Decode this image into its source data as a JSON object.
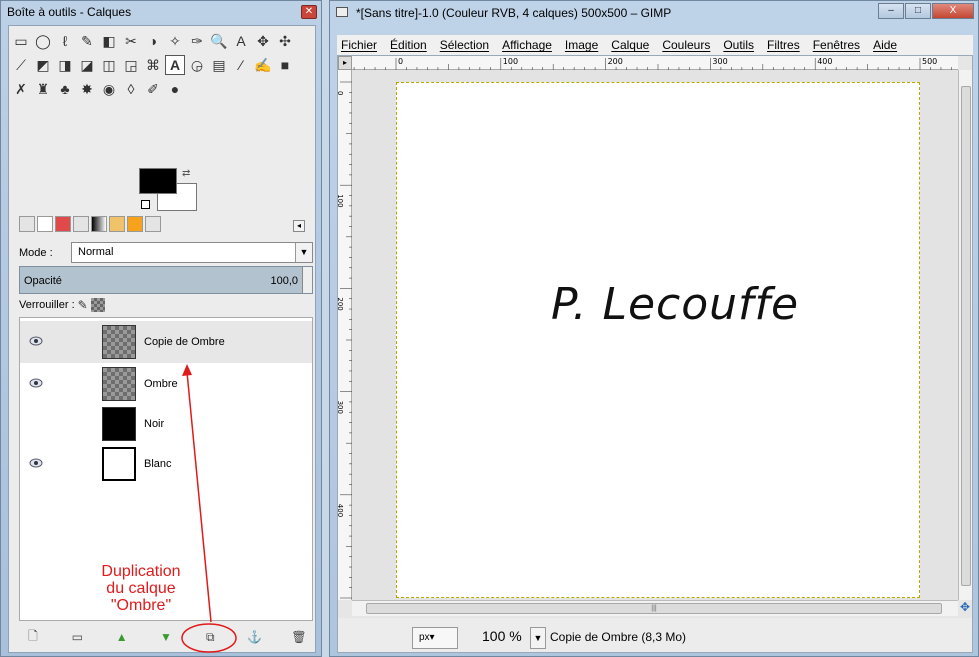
{
  "toolbox": {
    "title": "Boîte à outils - Calques",
    "close": "✕",
    "tools": [
      "▭",
      "◯",
      "ℓ",
      "✎",
      "◧",
      "✂",
      "◑",
      "✧",
      "✑",
      "🔍",
      "A",
      "✥",
      "✣",
      "⟋",
      "◩",
      "◨",
      "◪",
      "◫",
      "◲",
      "⌘",
      "A",
      "◶",
      "▤",
      "∕",
      "✍",
      "■",
      "✗",
      "♜",
      "♣",
      "✸",
      "◉",
      "◊",
      "✐",
      "●"
    ],
    "mode_label": "Mode :",
    "mode_value": "Normal",
    "opacity_label": "Opacité",
    "opacity_value": "100,0",
    "lock_label": "Verrouiller :",
    "layers": [
      {
        "name": "Copie de Ombre",
        "visible": true,
        "thumb": "checker",
        "active": true
      },
      {
        "name": "Ombre",
        "visible": true,
        "thumb": "checker",
        "active": false
      },
      {
        "name": "Noir",
        "visible": false,
        "thumb": "black",
        "active": false
      },
      {
        "name": "Blanc",
        "visible": true,
        "thumb": "white",
        "active": false
      }
    ],
    "annotation": [
      "Duplication",
      "du calque",
      "\"Ombre\""
    ],
    "layer_buttons": [
      "new-layer-icon",
      "open-folder-icon",
      "raise-layer-icon",
      "lower-layer-icon",
      "duplicate-layer-icon",
      "anchor-icon",
      "trash-icon"
    ]
  },
  "image_window": {
    "title": "*[Sans titre]-1.0 (Couleur RVB, 4 calques) 500x500 – GIMP",
    "controls": {
      "minimize": "–",
      "maximize": "□",
      "close": "X"
    },
    "menus": [
      "Fichier",
      "Édition",
      "Sélection",
      "Affichage",
      "Image",
      "Calque",
      "Couleurs",
      "Outils",
      "Filtres",
      "Fenêtres",
      "Aide"
    ],
    "hruler_labels": [
      "0",
      "100",
      "200",
      "300",
      "400",
      "500"
    ],
    "vruler_labels": [
      "0",
      "100",
      "200",
      "300",
      "400"
    ],
    "canvas_text": "P. Lecouffe",
    "unit": "px▾",
    "zoom": "100 %",
    "status": "Copie de Ombre (8,3 Mo)"
  },
  "colors": {
    "foreground": "#000000",
    "background": "#ffffff",
    "annotation": "#e01b1b",
    "selection_outline": "#b9a800"
  }
}
